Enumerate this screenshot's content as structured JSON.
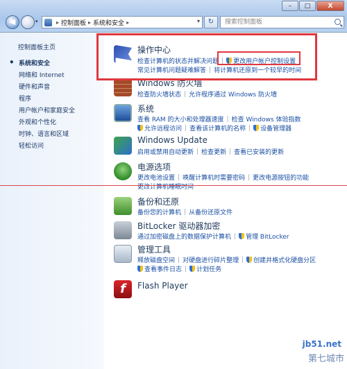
{
  "window": {
    "minimize": "–",
    "maximize": "□",
    "close": "X"
  },
  "nav": {
    "back_icon": "back-arrow-icon",
    "forward_icon": "forward-arrow-icon"
  },
  "address": {
    "crumbs": [
      "控制面板",
      "系统和安全"
    ],
    "refresh_icon": "refresh-icon"
  },
  "search": {
    "placeholder": "搜索控制面板"
  },
  "sidebar": {
    "items": [
      {
        "label": "控制面板主页",
        "current": false
      },
      {
        "label": "系统和安全",
        "current": true
      },
      {
        "label": "网络和 Internet",
        "current": false
      },
      {
        "label": "硬件和声音",
        "current": false
      },
      {
        "label": "程序",
        "current": false
      },
      {
        "label": "用户帐户和家庭安全",
        "current": false
      },
      {
        "label": "外观和个性化",
        "current": false
      },
      {
        "label": "时钟、语言和区域",
        "current": false
      },
      {
        "label": "轻松访问",
        "current": false
      }
    ]
  },
  "categories": {
    "action_center": {
      "title": "操作中心",
      "line1": [
        "检查计算机的状态并解决问题",
        "更改用户帐户控制设置"
      ],
      "line2": [
        "常见计算机问题疑难解答",
        "将计算机还原到一个较早的时间"
      ]
    },
    "firewall": {
      "title": "Windows 防火墙",
      "line1": [
        "检查防火墙状态",
        "允许程序通过 Windows 防火墙"
      ]
    },
    "system": {
      "title": "系统",
      "line1": [
        "查看 RAM 的大小和处理器速度",
        "检查 Windows 体验指数"
      ],
      "line2": [
        "允许远程访问",
        "查看该计算机的名称",
        "设备管理器"
      ]
    },
    "update": {
      "title": "Windows Update",
      "line1": [
        "启用或禁用自动更新",
        "检查更新",
        "查看已安装的更新"
      ]
    },
    "power": {
      "title": "电源选项",
      "line1": [
        "更改电池设置",
        "唤醒计算机时需要密码",
        "更改电源按钮的功能"
      ],
      "line2": [
        "更改计算机睡眠时间"
      ]
    },
    "backup": {
      "title": "备份和还原",
      "line1": [
        "备份您的计算机",
        "从备份还原文件"
      ]
    },
    "bitlocker": {
      "title": "BitLocker 驱动器加密",
      "line1": [
        "通过加密磁盘上的数据保护计算机",
        "管理 BitLocker"
      ]
    },
    "admin_tools": {
      "title": "管理工具",
      "line1": [
        "释放磁盘空间",
        "对硬盘进行碎片整理",
        "创建并格式化硬盘分区"
      ],
      "line2": [
        "查看事件日志",
        "计划任务"
      ]
    },
    "flash": {
      "title": "Flash Player"
    }
  },
  "watermark": {
    "site": "jb51.net",
    "brand": "第七城市"
  },
  "colors": {
    "link": "#1a4fa3",
    "highlight": "#e0383f"
  }
}
